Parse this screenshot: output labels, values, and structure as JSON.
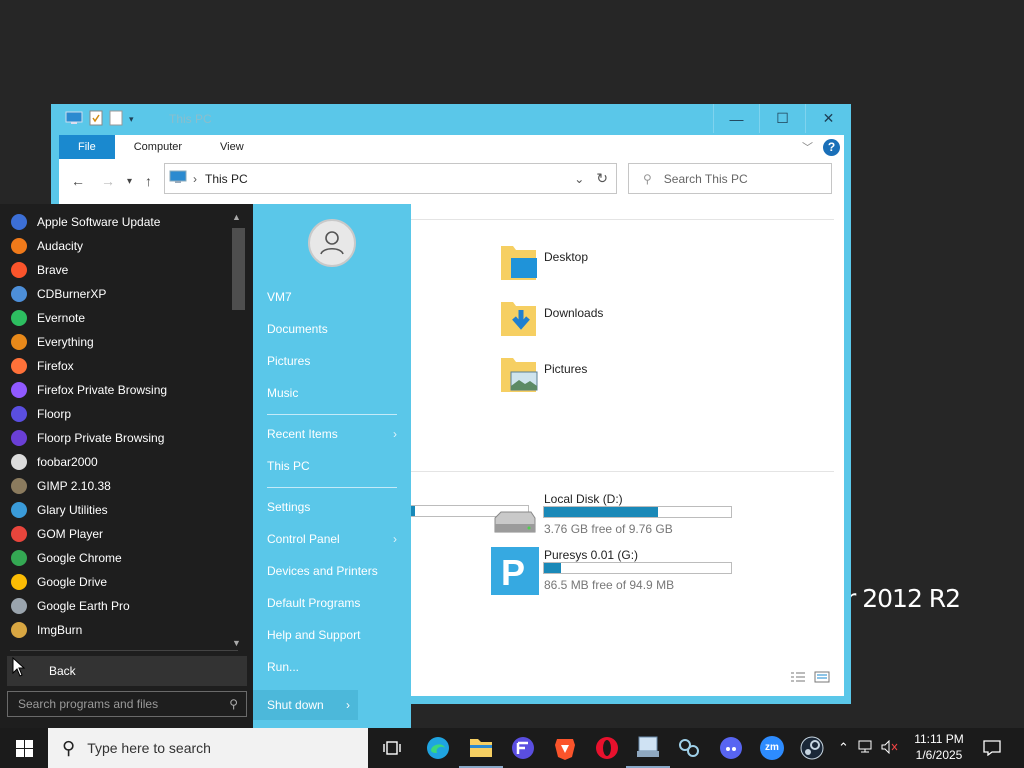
{
  "wallpaper": {
    "text": "r 2012 R2"
  },
  "explorer": {
    "title": "This PC",
    "window_buttons": {
      "minimize": "—",
      "maximize": "☐",
      "close": "✕"
    },
    "ribbon": {
      "tabs": [
        "File",
        "Computer",
        "View"
      ],
      "help": "?"
    },
    "address": {
      "path": "This PC"
    },
    "search": {
      "placeholder": "Search This PC"
    },
    "folders": [
      {
        "name": "Desktop",
        "icon": "desktop-folder-icon"
      },
      {
        "name": "Downloads",
        "icon": "downloads-folder-icon"
      },
      {
        "name": "Pictures",
        "icon": "pictures-folder-icon"
      }
    ],
    "drives": [
      {
        "name": "Local Disk (D:)",
        "free": "3.76 GB free of 9.76 GB",
        "used_fraction": 0.61,
        "icon": "hard-drive-icon"
      },
      {
        "name": "Puresys 0.01 (G:)",
        "free": "86.5 MB free of 94.9 MB",
        "used_fraction": 0.09,
        "icon": "puresys-drive-icon"
      }
    ],
    "partial_drive_used_fraction": 0.33
  },
  "start_menu": {
    "programs": [
      {
        "name": "Apple Software Update",
        "color": "#3c6fd6"
      },
      {
        "name": "Audacity",
        "color": "#f07a1a"
      },
      {
        "name": "Brave",
        "color": "#fb542b"
      },
      {
        "name": "CDBurnerXP",
        "color": "#4d8fd9"
      },
      {
        "name": "Evernote",
        "color": "#2dbe60"
      },
      {
        "name": "Everything",
        "color": "#e8891a"
      },
      {
        "name": "Firefox",
        "color": "#ff7139"
      },
      {
        "name": "Firefox Private Browsing",
        "color": "#9059ff"
      },
      {
        "name": "Floorp",
        "color": "#5a4ee0"
      },
      {
        "name": "Floorp Private Browsing",
        "color": "#6a3fd6"
      },
      {
        "name": "foobar2000",
        "color": "#dcdcdc"
      },
      {
        "name": "GIMP 2.10.38",
        "color": "#8b7b5e"
      },
      {
        "name": "Glary Utilities",
        "color": "#3a9bd9"
      },
      {
        "name": "GOM Player",
        "color": "#e8453c"
      },
      {
        "name": "Google Chrome",
        "color": "#34a853"
      },
      {
        "name": "Google Drive",
        "color": "#fbbc04"
      },
      {
        "name": "Google Earth Pro",
        "color": "#9aa4ad"
      },
      {
        "name": "ImgBurn",
        "color": "#d8a642"
      }
    ],
    "back": "Back",
    "search_placeholder": "Search programs and files",
    "right_items": {
      "user": "VM7",
      "documents": "Documents",
      "pictures": "Pictures",
      "music": "Music",
      "recent": "Recent Items",
      "thispc": "This PC",
      "settings": "Settings",
      "control_panel": "Control Panel",
      "devices": "Devices and Printers",
      "default_programs": "Default Programs",
      "help": "Help and Support",
      "run": "Run...",
      "shutdown": "Shut down"
    }
  },
  "taskbar": {
    "search_placeholder": "Type here to search",
    "apps": [
      "task-view-icon",
      "edge-icon",
      "file-explorer-icon",
      "floorp-icon",
      "brave-icon",
      "opera-icon",
      "network-app-icon",
      "connections-icon",
      "discord-icon",
      "zoom-icon",
      "steam-icon"
    ],
    "zoom_label": "zm",
    "time": "11:11 PM",
    "date": "1/6/2025"
  }
}
